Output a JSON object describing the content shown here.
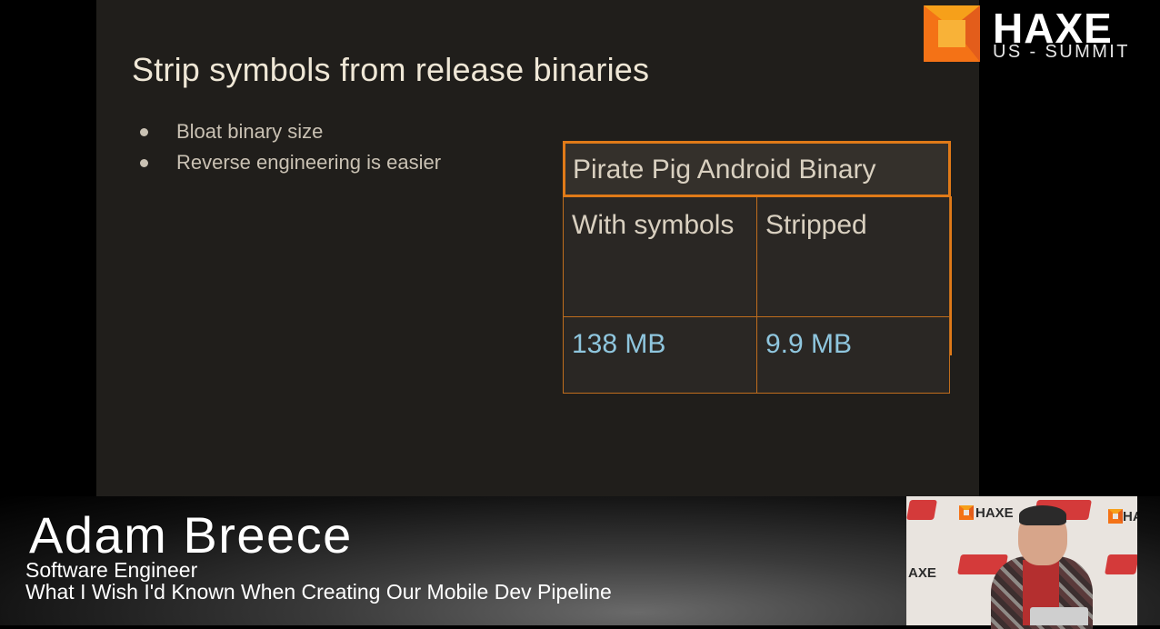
{
  "slide": {
    "title": "Strip symbols from release binaries",
    "bullets": [
      "Bloat binary size",
      "Reverse engineering is easier"
    ],
    "table": {
      "caption": "Pirate Pig Android Binary",
      "headers": [
        "With symbols",
        "Stripped"
      ],
      "values": [
        "138 MB",
        "9.9 MB"
      ]
    }
  },
  "branding": {
    "logo_word": "HAXE",
    "logo_sub": "US - SUMMIT",
    "logo_colors": [
      "#f47216",
      "#f6a01a",
      "#e35d1b"
    ]
  },
  "lower_third": {
    "speaker_name": "Adam Breece",
    "role": "Software Engineer",
    "talk_title": "What I Wish I'd Known When Creating Our Mobile Dev Pipeline"
  },
  "camera": {
    "backdrop_words": [
      "HAXE",
      "HA",
      "AXE"
    ],
    "banner_color": "#d43a3a"
  }
}
